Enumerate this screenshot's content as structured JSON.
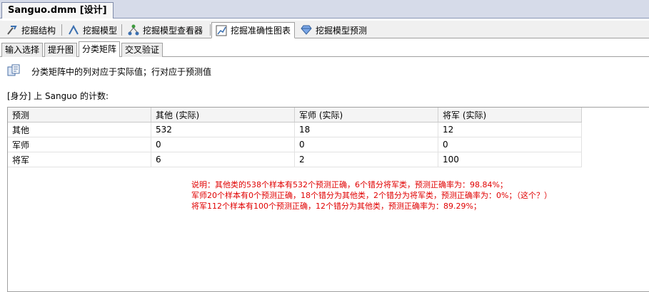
{
  "document_tab": {
    "title": "Sanguo.dmm [设计]"
  },
  "designer_tabs": [
    {
      "label": "挖掘结构",
      "icon": "mining-structure-icon"
    },
    {
      "label": "挖掘模型",
      "icon": "mining-model-icon"
    },
    {
      "label": "挖掘模型查看器",
      "icon": "model-viewer-icon"
    },
    {
      "label": "挖掘准确性图表",
      "icon": "accuracy-chart-icon",
      "active": true
    },
    {
      "label": "挖掘模型预测",
      "icon": "model-prediction-icon"
    }
  ],
  "sub_tabs": [
    {
      "label": "输入选择"
    },
    {
      "label": "提升图"
    },
    {
      "label": "分类矩阵",
      "active": true
    },
    {
      "label": "交叉验证"
    }
  ],
  "description": "分类矩阵中的列对应于实际值；行对应于预测值",
  "count_title": "[身分] 上 Sanguo 的计数:",
  "matrix": {
    "headers": [
      "预测",
      "其他 (实际)",
      "军师 (实际)",
      "将军 (实际)"
    ],
    "rows": [
      [
        "其他",
        "532",
        "18",
        "12"
      ],
      [
        "军师",
        "0",
        "0",
        "0"
      ],
      [
        "将军",
        "6",
        "2",
        "100"
      ]
    ]
  },
  "note_lines": [
    "说明：其他类的538个样本有532个预测正确，6个错分将军类，预测正确率为：98.84%；",
    "军师20个样本有0个预测正确，18个错分为其他类，2个错分为将军类，预测正确率为：0%；（这个？）",
    "将军112个样本有100个预测正确，12个错分为其他类，预测正确率为：89.29%；"
  ],
  "colors": {
    "note_text": "#e00000",
    "strip_bg": "#d6dbe9"
  }
}
